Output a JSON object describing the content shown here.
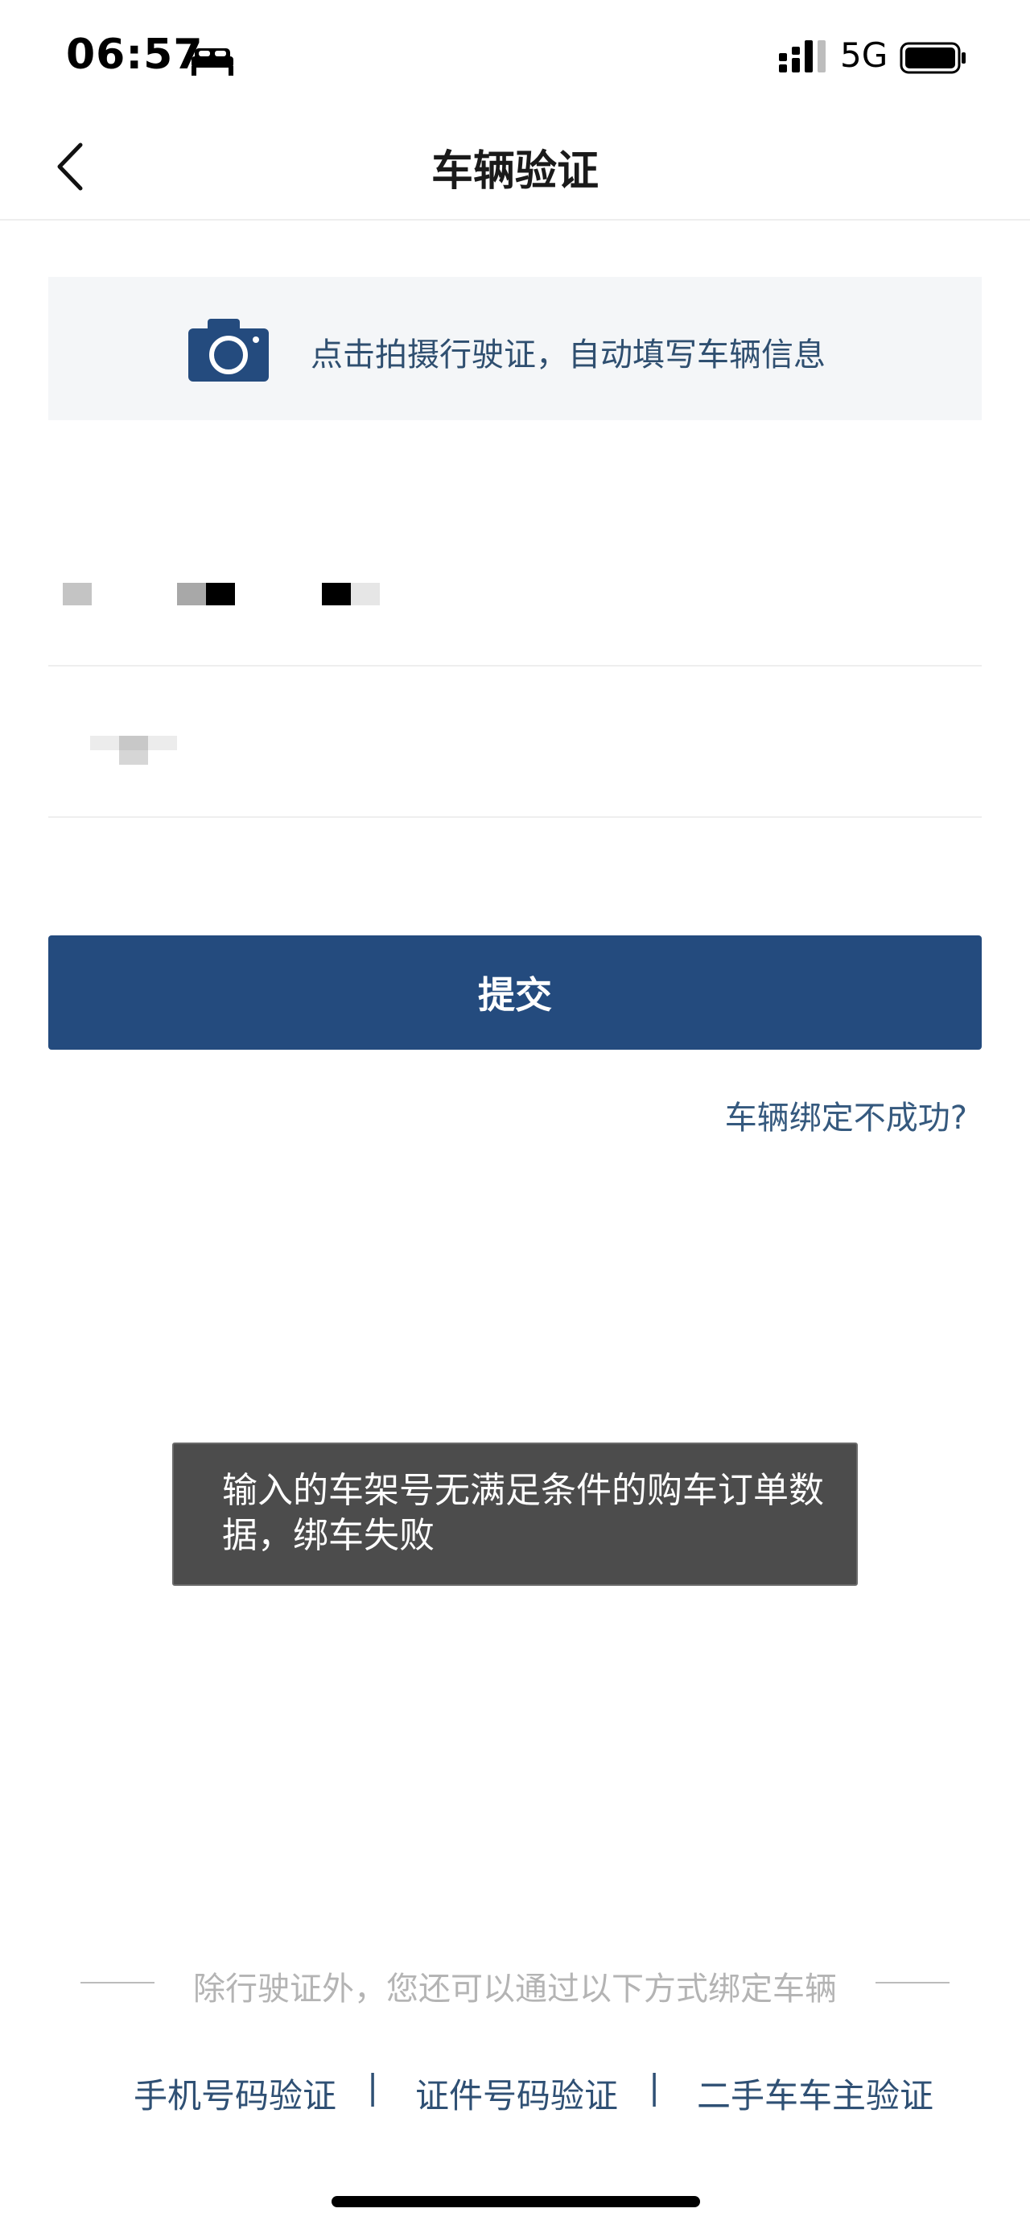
{
  "status_bar": {
    "time": "06:57",
    "network": "5G",
    "icons": [
      "bed-icon",
      "signal-icon",
      "battery-icon"
    ]
  },
  "nav": {
    "title": "车辆验证",
    "back_icon": "chevron-left-icon"
  },
  "scan_banner": {
    "icon": "camera-icon",
    "text": "点击拍摄行驶证，自动填写车辆信息"
  },
  "form": {
    "field_1_value": "",
    "field_2_value": ""
  },
  "submit": {
    "label": "提交"
  },
  "help_link": {
    "label": "车辆绑定不成功?"
  },
  "toast": {
    "message": "输入的车架号无满足条件的购车订单数据，绑车失败"
  },
  "alternatives": {
    "divider_text": "除行驶证外，您还可以通过以下方式绑定车辆",
    "methods": [
      "手机号码验证",
      "证件号码验证",
      "二手车车主验证"
    ],
    "separator": "|"
  },
  "colors": {
    "primary": "#244b7e",
    "link": "#35597e",
    "banner_bg": "#f4f6f8",
    "toast_bg": "#4c4c4c"
  }
}
